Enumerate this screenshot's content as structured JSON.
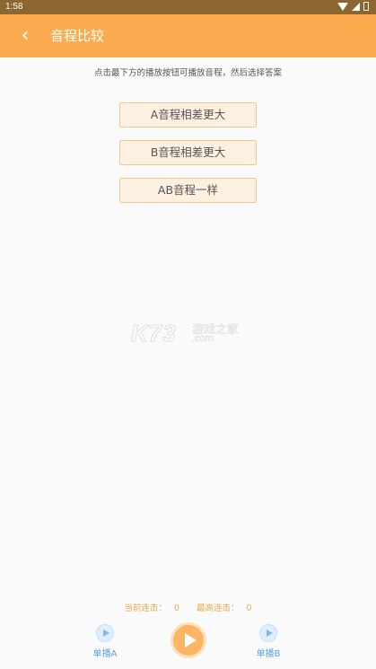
{
  "status_bar": {
    "time": "1:58"
  },
  "app_bar": {
    "back_icon": "chevron-left-icon",
    "title": "音程比较"
  },
  "instruction": "点击最下方的播放按钮可播放音程，然后选择答案",
  "options": [
    {
      "label": "A音程相差更大"
    },
    {
      "label": "B音程相差更大"
    },
    {
      "label": "AB音程一样"
    }
  ],
  "watermark": {
    "logo": "K73",
    "site_cn": "游戏之家",
    "site_domain": ".com"
  },
  "streak": {
    "current_label": "当前连击：",
    "current_value": "0",
    "best_label": "最高连击：",
    "best_value": "0"
  },
  "controls": {
    "play_a_label": "单播A",
    "play_b_label": "单播B",
    "main_play_icon": "play-icon"
  },
  "colors": {
    "accent": "#fdab4f",
    "status_bar": "#8c6630",
    "option_bg": "#fdf0e1",
    "option_border": "#f2c894",
    "streak_text": "#f4a74c",
    "single_play_text": "#5aa2e4"
  }
}
